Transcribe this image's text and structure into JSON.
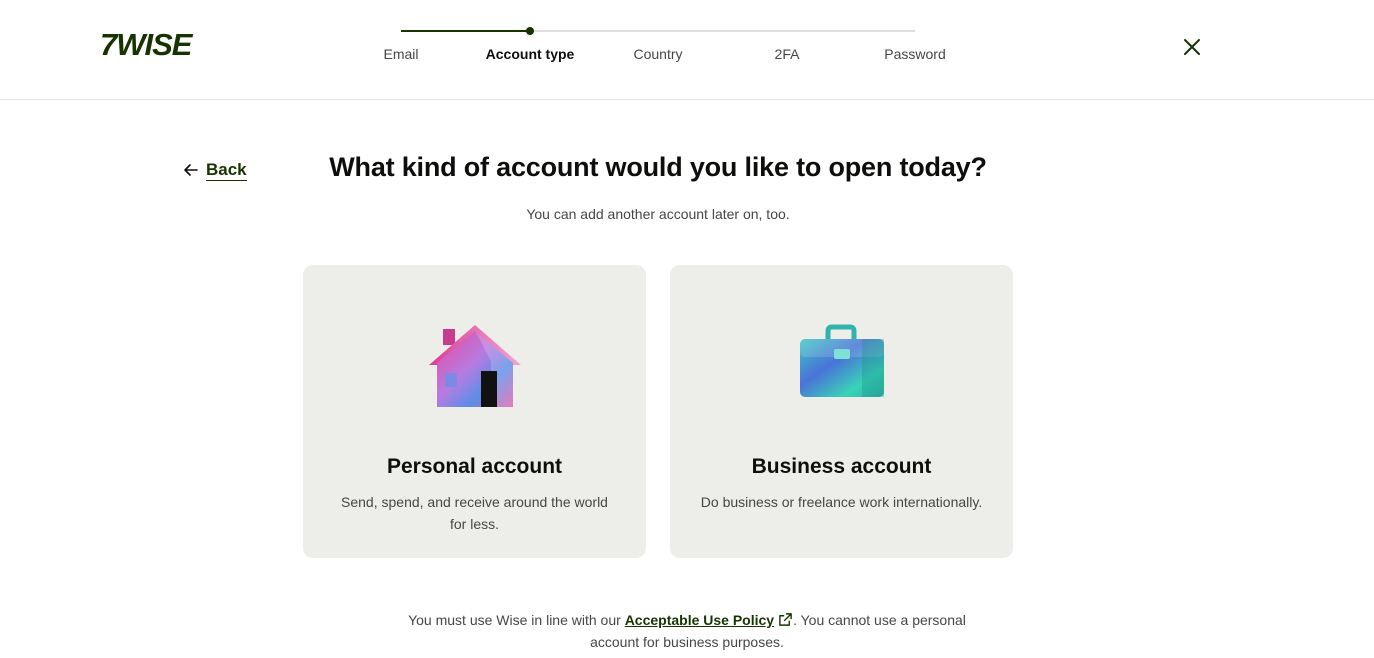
{
  "header": {
    "logo_text": "7WISE",
    "steps": [
      {
        "label": "Email",
        "active": false
      },
      {
        "label": "Account type",
        "active": true
      },
      {
        "label": "Country",
        "active": false
      },
      {
        "label": "2FA",
        "active": false
      },
      {
        "label": "Password",
        "active": false
      }
    ],
    "progress_fraction": 0.25,
    "close_icon": "close-icon"
  },
  "back": {
    "label": "Back",
    "icon": "arrow-left-icon"
  },
  "page": {
    "title": "What kind of account would you like to open today?",
    "subtitle": "You can add another account later on, too."
  },
  "cards": [
    {
      "title": "Personal account",
      "description": "Send, spend, and receive around the world for less.",
      "illustration": "house-illustration"
    },
    {
      "title": "Business account",
      "description": "Do business or freelance work internationally.",
      "illustration": "briefcase-illustration"
    }
  ],
  "footer": {
    "prefix": "You must use Wise in line with our ",
    "link": "Acceptable Use Policy",
    "suffix": ". You cannot use a personal account for business purposes.",
    "link_icon": "external-link-icon"
  },
  "colors": {
    "brand": "#163300",
    "card_bg": "#edeeea",
    "text_secondary": "#454745"
  }
}
